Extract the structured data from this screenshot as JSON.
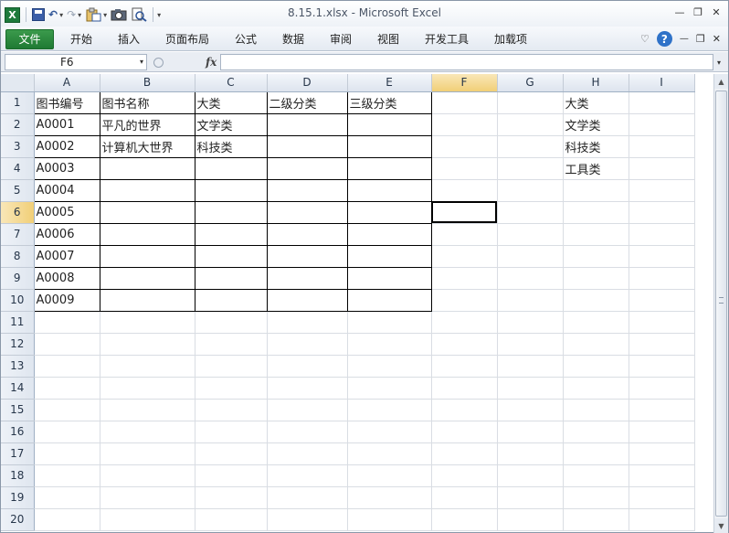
{
  "window": {
    "title": "8.15.1.xlsx  -  Microsoft Excel",
    "controls": [
      "—",
      "❐",
      "✕"
    ]
  },
  "qat": {
    "customize": "▾"
  },
  "ribbon": {
    "tabs": [
      "文件",
      "开始",
      "插入",
      "页面布局",
      "公式",
      "数据",
      "审阅",
      "视图",
      "开发工具",
      "加载项"
    ],
    "right_icons": [
      "♡",
      "?",
      "—",
      "❐",
      "✕"
    ]
  },
  "formula_bar": {
    "name_box": "F6",
    "fx": "fx",
    "formula": ""
  },
  "sheet": {
    "columns": [
      "A",
      "B",
      "C",
      "D",
      "E",
      "F",
      "G",
      "H",
      "I"
    ],
    "rows": [
      {
        "n": "1",
        "cells": [
          "图书编号",
          "图书名称",
          "大类",
          "二级分类",
          "三级分类",
          "",
          "",
          "大类",
          ""
        ]
      },
      {
        "n": "2",
        "cells": [
          "A0001",
          "平凡的世界",
          "文学类",
          "",
          "",
          "",
          "",
          "文学类",
          ""
        ]
      },
      {
        "n": "3",
        "cells": [
          "A0002",
          "计算机大世界",
          "科技类",
          "",
          "",
          "",
          "",
          "科技类",
          ""
        ]
      },
      {
        "n": "4",
        "cells": [
          "A0003",
          "",
          "",
          "",
          "",
          "",
          "",
          "工具类",
          ""
        ]
      },
      {
        "n": "5",
        "cells": [
          "A0004",
          "",
          "",
          "",
          "",
          "",
          "",
          "",
          ""
        ]
      },
      {
        "n": "6",
        "cells": [
          "A0005",
          "",
          "",
          "",
          "",
          "",
          "",
          "",
          ""
        ]
      },
      {
        "n": "7",
        "cells": [
          "A0006",
          "",
          "",
          "",
          "",
          "",
          "",
          "",
          ""
        ]
      },
      {
        "n": "8",
        "cells": [
          "A0007",
          "",
          "",
          "",
          "",
          "",
          "",
          "",
          ""
        ]
      },
      {
        "n": "9",
        "cells": [
          "A0008",
          "",
          "",
          "",
          "",
          "",
          "",
          "",
          ""
        ]
      },
      {
        "n": "10",
        "cells": [
          "A0009",
          "",
          "",
          "",
          "",
          "",
          "",
          "",
          ""
        ]
      },
      {
        "n": "11",
        "cells": [
          "",
          "",
          "",
          "",
          "",
          "",
          "",
          "",
          ""
        ]
      },
      {
        "n": "12",
        "cells": [
          "",
          "",
          "",
          "",
          "",
          "",
          "",
          "",
          ""
        ]
      },
      {
        "n": "13",
        "cells": [
          "",
          "",
          "",
          "",
          "",
          "",
          "",
          "",
          ""
        ]
      },
      {
        "n": "14",
        "cells": [
          "",
          "",
          "",
          "",
          "",
          "",
          "",
          "",
          ""
        ]
      },
      {
        "n": "15",
        "cells": [
          "",
          "",
          "",
          "",
          "",
          "",
          "",
          "",
          ""
        ]
      },
      {
        "n": "16",
        "cells": [
          "",
          "",
          "",
          "",
          "",
          "",
          "",
          "",
          ""
        ]
      },
      {
        "n": "17",
        "cells": [
          "",
          "",
          "",
          "",
          "",
          "",
          "",
          "",
          ""
        ]
      },
      {
        "n": "18",
        "cells": [
          "",
          "",
          "",
          "",
          "",
          "",
          "",
          "",
          ""
        ]
      },
      {
        "n": "19",
        "cells": [
          "",
          "",
          "",
          "",
          "",
          "",
          "",
          "",
          ""
        ]
      },
      {
        "n": "20",
        "cells": [
          "",
          "",
          "",
          "",
          "",
          "",
          "",
          "",
          ""
        ]
      }
    ]
  },
  "scrollbar": {
    "up": "▲",
    "down": "▼"
  }
}
